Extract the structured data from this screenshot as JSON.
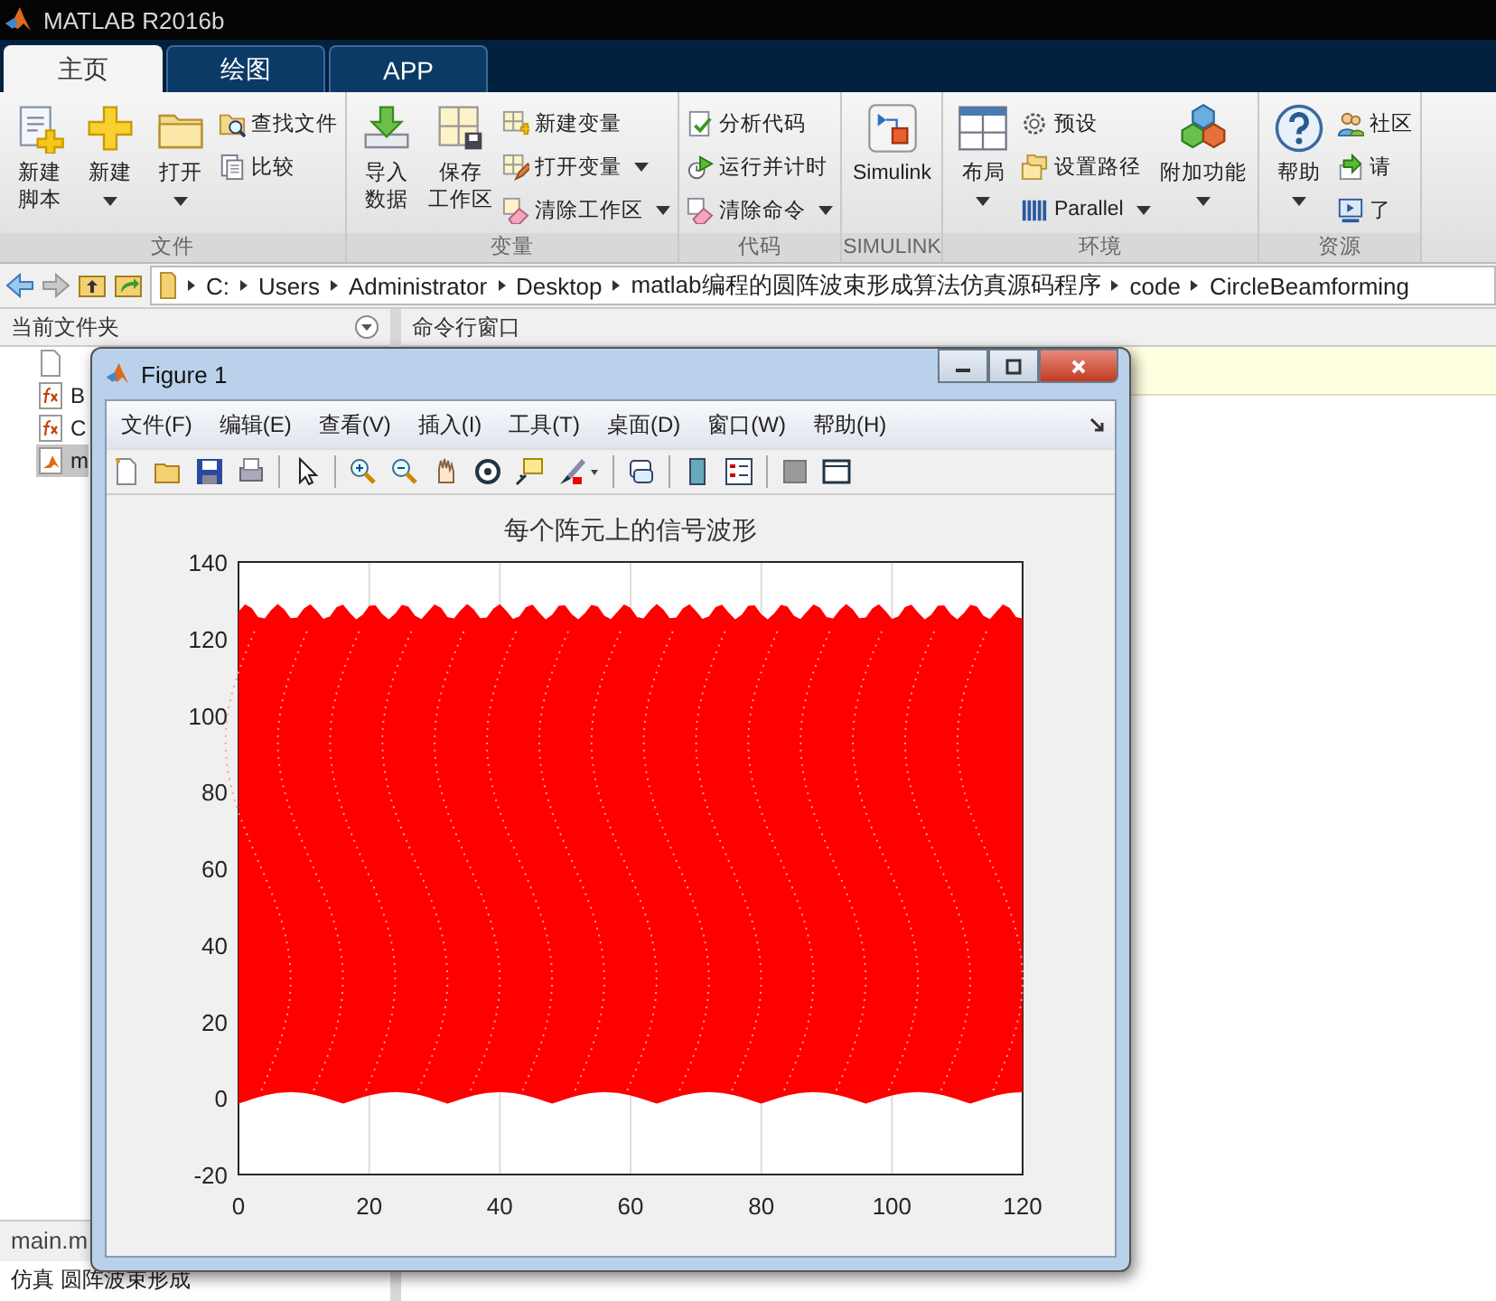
{
  "app": {
    "title": "MATLAB R2016b"
  },
  "tabs": [
    {
      "label": "主页",
      "selected": true
    },
    {
      "label": "绘图",
      "selected": false
    },
    {
      "label": "APP",
      "selected": false
    }
  ],
  "ribbon": {
    "groups": [
      {
        "label": "文件",
        "items": [
          {
            "kind": "large",
            "lines": [
              "新建",
              "脚本"
            ],
            "dropdown": false
          },
          {
            "kind": "large",
            "lines": [
              "新建"
            ],
            "dropdown": true
          },
          {
            "kind": "large",
            "lines": [
              "打开"
            ],
            "dropdown": true
          },
          {
            "kind": "small",
            "label": "查找文件",
            "dropdown": false
          },
          {
            "kind": "small",
            "label": "比较",
            "dropdown": false
          }
        ]
      },
      {
        "label": "变量",
        "items": [
          {
            "kind": "large",
            "lines": [
              "导入",
              "数据"
            ],
            "dropdown": false
          },
          {
            "kind": "large",
            "lines": [
              "保存",
              "工作区"
            ],
            "dropdown": false
          },
          {
            "kind": "small",
            "label": "新建变量",
            "dropdown": false
          },
          {
            "kind": "small",
            "label": "打开变量",
            "dropdown": true
          },
          {
            "kind": "small",
            "label": "清除工作区",
            "dropdown": true
          }
        ]
      },
      {
        "label": "代码",
        "items": [
          {
            "kind": "small",
            "label": "分析代码",
            "dropdown": false
          },
          {
            "kind": "small",
            "label": "运行并计时",
            "dropdown": false
          },
          {
            "kind": "small",
            "label": "清除命令",
            "dropdown": true
          }
        ]
      },
      {
        "label": "SIMULINK",
        "items": [
          {
            "kind": "large",
            "lines": [
              "Simulink"
            ],
            "dropdown": false
          }
        ]
      },
      {
        "label": "环境",
        "items": [
          {
            "kind": "large",
            "lines": [
              "布局"
            ],
            "dropdown": true
          },
          {
            "kind": "small",
            "label": "预设",
            "dropdown": false
          },
          {
            "kind": "small",
            "label": "设置路径",
            "dropdown": false
          },
          {
            "kind": "small",
            "label": "Parallel",
            "dropdown": true
          },
          {
            "kind": "large",
            "lines": [
              "附加功能"
            ],
            "dropdown": true
          }
        ]
      },
      {
        "label": "资源",
        "items": [
          {
            "kind": "large",
            "lines": [
              "帮助"
            ],
            "dropdown": true
          },
          {
            "kind": "small",
            "label": "社区",
            "dropdown": false
          },
          {
            "kind": "small",
            "label": "请",
            "dropdown": false
          },
          {
            "kind": "small",
            "label": "了",
            "dropdown": false
          }
        ]
      }
    ]
  },
  "path": [
    "C:",
    "Users",
    "Administrator",
    "Desktop",
    "matlab编程的圆阵波束形成算法仿真源码程序",
    "code",
    "CircleBeamforming"
  ],
  "file_panel": {
    "title": "当前文件夹",
    "rows": [
      {
        "kind": "function",
        "label": "B",
        "selected": false
      },
      {
        "kind": "function",
        "label": "C",
        "selected": false
      },
      {
        "kind": "script",
        "label": "m",
        "selected": true
      }
    ],
    "footer": "main.m",
    "description": "仿真 圆阵波束形成"
  },
  "command_window": {
    "title": "命令行窗口"
  },
  "figure": {
    "title": "Figure 1",
    "menu": [
      "文件(F)",
      "编辑(E)",
      "查看(V)",
      "插入(I)",
      "工具(T)",
      "桌面(D)",
      "窗口(W)",
      "帮助(H)"
    ],
    "chart_data": {
      "type": "line",
      "grid": true,
      "title": "每个阵元上的信号波形",
      "xlim": [
        0,
        120
      ],
      "ylim": [
        -20,
        140
      ],
      "xticks": [
        0,
        20,
        40,
        60,
        80,
        100,
        120
      ],
      "yticks": [
        -20,
        0,
        20,
        40,
        60,
        80,
        100,
        120,
        140
      ]
    }
  }
}
